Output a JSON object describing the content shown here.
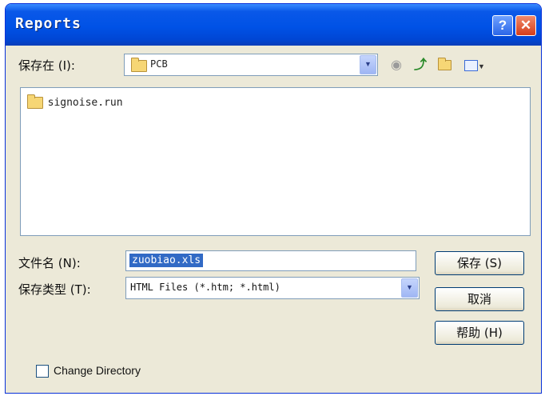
{
  "window": {
    "title": "Reports"
  },
  "titlebar": {
    "help_glyph": "?",
    "close_glyph": "✕"
  },
  "save_in": {
    "label": "保存在 (I):",
    "value": "PCB"
  },
  "toolbar": {
    "back_icon": "back-icon",
    "up_icon": "up-folder-icon",
    "new_folder_icon": "new-folder-icon",
    "views_icon": "views-menu-icon"
  },
  "file_list": {
    "items": [
      {
        "name": "signoise.run",
        "icon": "folder-icon"
      }
    ]
  },
  "file_name": {
    "label": "文件名 (N):",
    "value": "zuobiao.xls"
  },
  "save_type": {
    "label": "保存类型 (T):",
    "value": "HTML Files (*.htm; *.html)"
  },
  "buttons": {
    "save": "保存 (S)",
    "cancel": "取消",
    "help": "帮助 (H)"
  },
  "change_directory": {
    "label": "Change Directory",
    "checked": false
  }
}
